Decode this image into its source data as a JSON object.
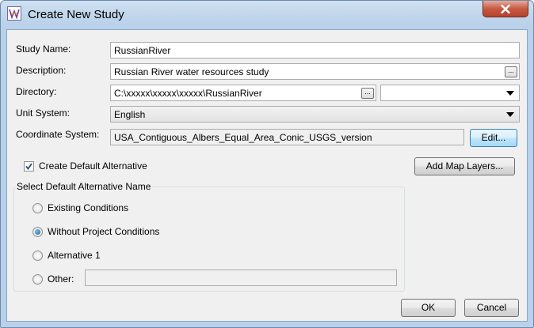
{
  "window": {
    "title": "Create New Study",
    "icon": "hec-ras-app-icon",
    "close_icon": "close-icon"
  },
  "form": {
    "study_name": {
      "label": "Study Name:",
      "value": "RussianRiver"
    },
    "description": {
      "label": "Description:",
      "value": "Russian River water resources study",
      "browse_label": "..."
    },
    "directory": {
      "label": "Directory:",
      "value": "C:\\xxxxx\\xxxxx\\xxxxx\\RussianRiver",
      "browse_label": "...",
      "combo_value": ""
    },
    "unit_system": {
      "label": "Unit System:",
      "value": "English"
    },
    "coordinate_system": {
      "label": "Coordinate System:",
      "value": "USA_Contiguous_Albers_Equal_Area_Conic_USGS_version",
      "edit_label": "Edit..."
    }
  },
  "create_default": {
    "label": "Create Default Alternative",
    "checked": true
  },
  "add_map_layers_label": "Add Map Layers...",
  "alternative_group": {
    "legend": "Select Default Alternative Name",
    "options": [
      {
        "label": "Existing Conditions",
        "selected": false
      },
      {
        "label": "Without Project Conditions",
        "selected": true
      },
      {
        "label": "Alternative 1",
        "selected": false
      },
      {
        "label": "Other:",
        "selected": false
      }
    ],
    "other_value": ""
  },
  "buttons": {
    "ok": "OK",
    "cancel": "Cancel"
  },
  "colors": {
    "title_bar": "#b9d1ea",
    "close_button": "#c75a45",
    "dialog_bg": "#f0f0f0",
    "radio_selected": "#1c5c9c"
  }
}
